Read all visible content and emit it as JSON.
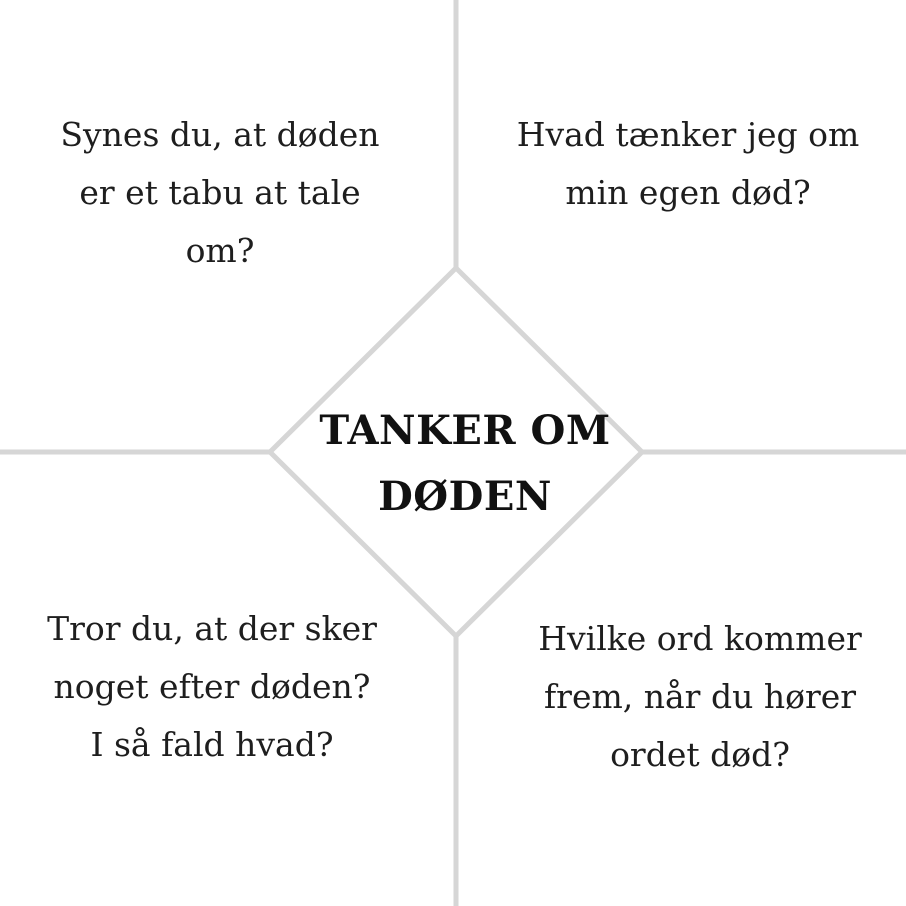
{
  "title": "TANKER OM\nDØDEN",
  "questions": {
    "top_left": "Synes du, at døden\ner et tabu at tale\nom?",
    "top_right": "Hvad tænker jeg om\nmin egen død?",
    "bottom_left": "Tror du, at der sker\nnoget efter døden?\nI så fald hvad?",
    "bottom_right": "Hvilke ord kommer\nfrem, når du hører\nordet død?"
  },
  "colors": {
    "line": "#d6d6d6",
    "text": "#1e1e1e",
    "background": "#ffffff"
  }
}
